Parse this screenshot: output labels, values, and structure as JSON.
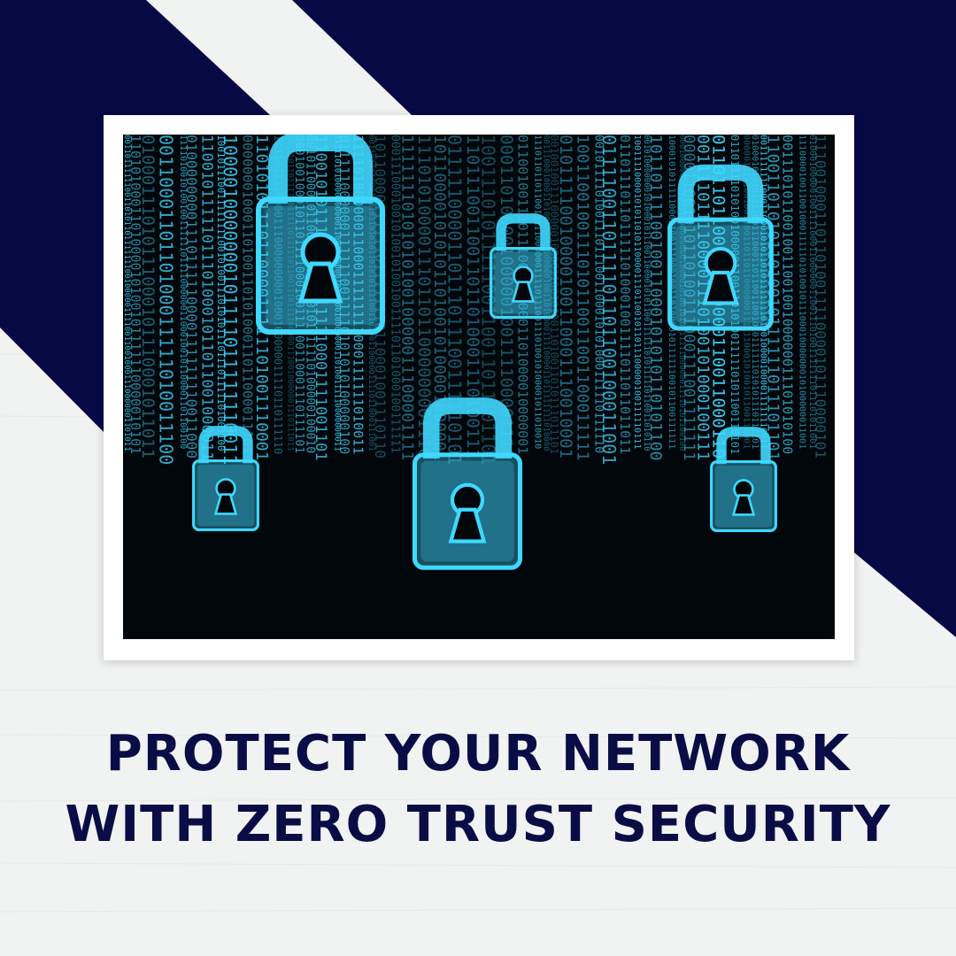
{
  "colors": {
    "navy": "#050a45",
    "background": "#f1f2f2",
    "frame": "#ffffff",
    "code_glow": "#3fd8ff",
    "headline": "#0a0d45"
  },
  "photo": {
    "subject": "binary code rain with padlock icons",
    "icons": [
      "padlock-icon",
      "padlock-icon",
      "padlock-icon",
      "padlock-icon",
      "padlock-icon",
      "padlock-icon"
    ]
  },
  "headline": {
    "line1": "PROTECT YOUR NETWORK",
    "line2": "WITH ZERO TRUST SECURITY"
  }
}
